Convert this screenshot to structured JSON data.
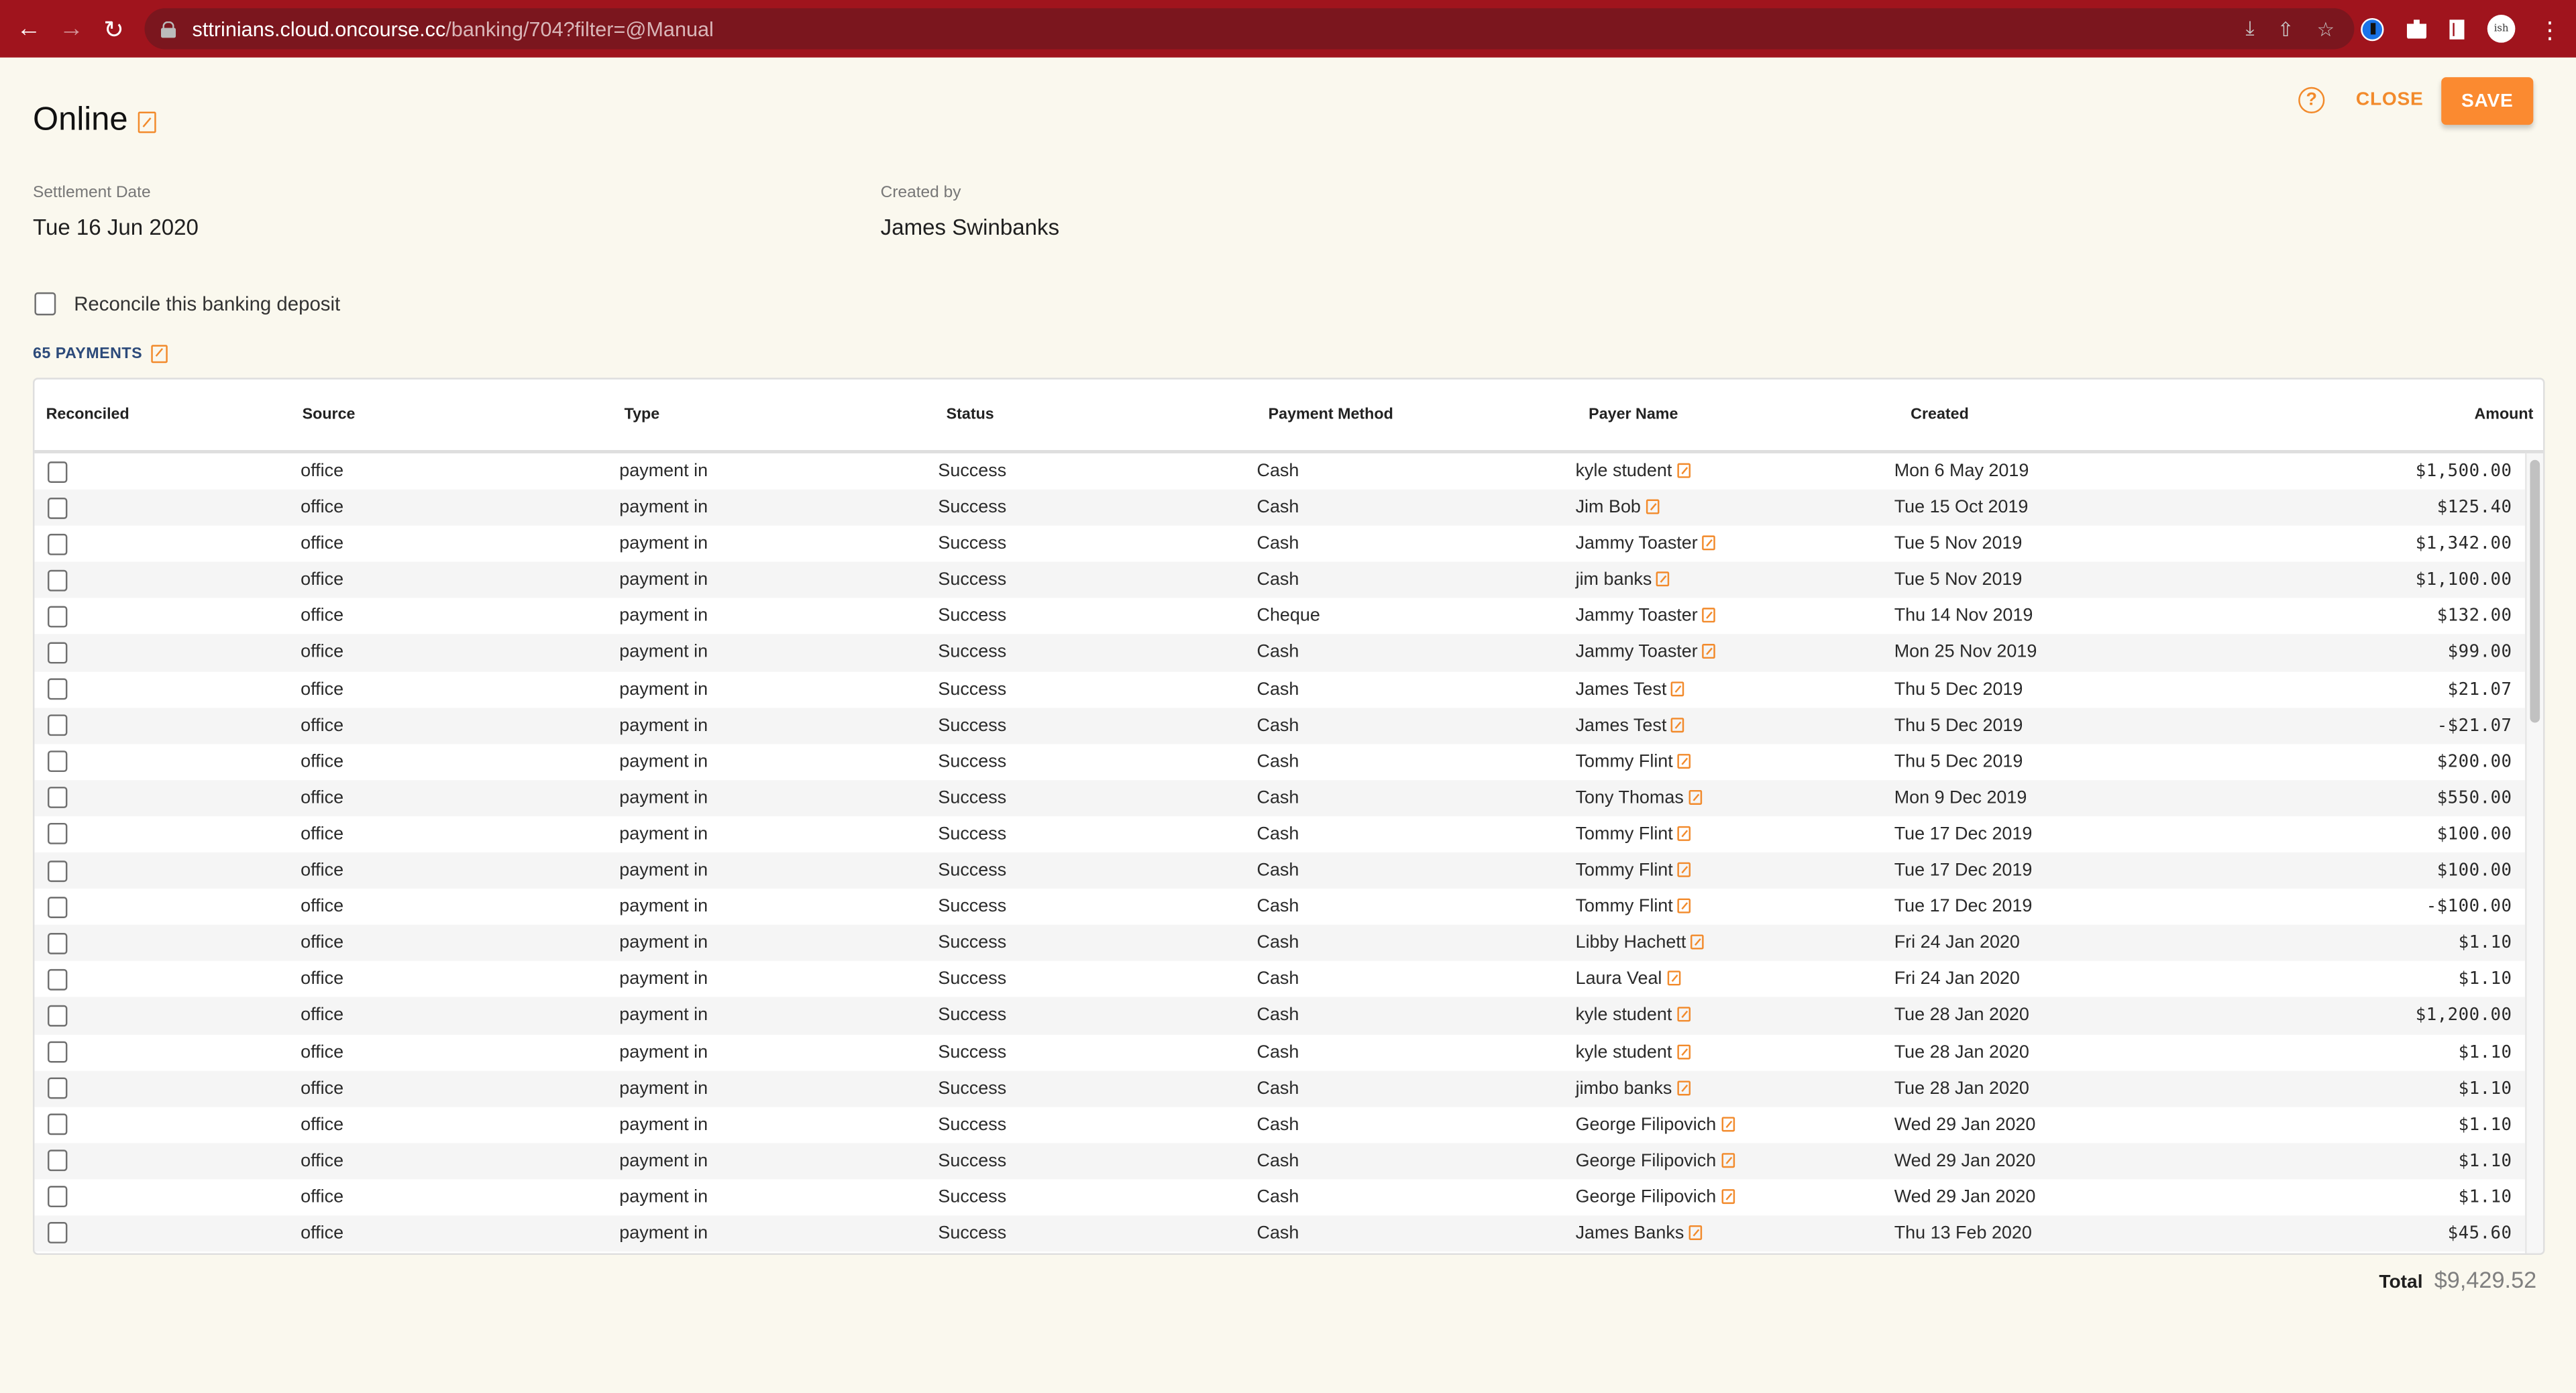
{
  "browser": {
    "url_host": "sttrinians.cloud.oncourse.cc",
    "url_path": "/banking/704?filter=@Manual",
    "icons": [
      "back-icon",
      "forward-icon",
      "reload-icon",
      "lock-icon",
      "install-icon",
      "share-icon",
      "bookmark-star-icon",
      "password-manager-icon",
      "extensions-icon",
      "side-panel-icon",
      "profile-avatar",
      "menu-icon"
    ],
    "avatar_text": "ish"
  },
  "header": {
    "title": "Online",
    "close_label": "CLOSE",
    "save_label": "SAVE",
    "help_glyph": "?"
  },
  "fields": {
    "settlement_date_label": "Settlement Date",
    "settlement_date_value": "Tue 16 Jun 2020",
    "created_by_label": "Created by",
    "created_by_value": "James Swinbanks"
  },
  "reconcile_label": "Reconcile this banking deposit",
  "reconcile_checked": false,
  "payments_link_label": "65 PAYMENTS",
  "table": {
    "columns": [
      "Reconciled",
      "Source",
      "Type",
      "Status",
      "Payment Method",
      "Payer Name",
      "Created",
      "Amount"
    ],
    "rows": [
      {
        "reconciled": false,
        "source": "office",
        "type": "payment in",
        "status": "Success",
        "method": "Cash",
        "payer": "kyle student",
        "created": "Mon 6 May 2019",
        "amount": "$1,500.00"
      },
      {
        "reconciled": false,
        "source": "office",
        "type": "payment in",
        "status": "Success",
        "method": "Cash",
        "payer": "Jim Bob",
        "created": "Tue 15 Oct 2019",
        "amount": "$125.40"
      },
      {
        "reconciled": false,
        "source": "office",
        "type": "payment in",
        "status": "Success",
        "method": "Cash",
        "payer": "Jammy Toaster",
        "created": "Tue 5 Nov 2019",
        "amount": "$1,342.00"
      },
      {
        "reconciled": false,
        "source": "office",
        "type": "payment in",
        "status": "Success",
        "method": "Cash",
        "payer": "jim banks",
        "created": "Tue 5 Nov 2019",
        "amount": "$1,100.00"
      },
      {
        "reconciled": false,
        "source": "office",
        "type": "payment in",
        "status": "Success",
        "method": "Cheque",
        "payer": "Jammy Toaster",
        "created": "Thu 14 Nov 2019",
        "amount": "$132.00"
      },
      {
        "reconciled": false,
        "source": "office",
        "type": "payment in",
        "status": "Success",
        "method": "Cash",
        "payer": "Jammy Toaster",
        "created": "Mon 25 Nov 2019",
        "amount": "$99.00"
      },
      {
        "reconciled": false,
        "source": "office",
        "type": "payment in",
        "status": "Success",
        "method": "Cash",
        "payer": "James Test",
        "created": "Thu 5 Dec 2019",
        "amount": "$21.07"
      },
      {
        "reconciled": false,
        "source": "office",
        "type": "payment in",
        "status": "Success",
        "method": "Cash",
        "payer": "James Test",
        "created": "Thu 5 Dec 2019",
        "amount": "-$21.07"
      },
      {
        "reconciled": false,
        "source": "office",
        "type": "payment in",
        "status": "Success",
        "method": "Cash",
        "payer": "Tommy Flint",
        "created": "Thu 5 Dec 2019",
        "amount": "$200.00"
      },
      {
        "reconciled": false,
        "source": "office",
        "type": "payment in",
        "status": "Success",
        "method": "Cash",
        "payer": "Tony Thomas",
        "created": "Mon 9 Dec 2019",
        "amount": "$550.00"
      },
      {
        "reconciled": false,
        "source": "office",
        "type": "payment in",
        "status": "Success",
        "method": "Cash",
        "payer": "Tommy Flint",
        "created": "Tue 17 Dec 2019",
        "amount": "$100.00"
      },
      {
        "reconciled": false,
        "source": "office",
        "type": "payment in",
        "status": "Success",
        "method": "Cash",
        "payer": "Tommy Flint",
        "created": "Tue 17 Dec 2019",
        "amount": "$100.00"
      },
      {
        "reconciled": false,
        "source": "office",
        "type": "payment in",
        "status": "Success",
        "method": "Cash",
        "payer": "Tommy Flint",
        "created": "Tue 17 Dec 2019",
        "amount": "-$100.00"
      },
      {
        "reconciled": false,
        "source": "office",
        "type": "payment in",
        "status": "Success",
        "method": "Cash",
        "payer": "Libby Hachett",
        "created": "Fri 24 Jan 2020",
        "amount": "$1.10"
      },
      {
        "reconciled": false,
        "source": "office",
        "type": "payment in",
        "status": "Success",
        "method": "Cash",
        "payer": "Laura Veal",
        "created": "Fri 24 Jan 2020",
        "amount": "$1.10"
      },
      {
        "reconciled": false,
        "source": "office",
        "type": "payment in",
        "status": "Success",
        "method": "Cash",
        "payer": "kyle student",
        "created": "Tue 28 Jan 2020",
        "amount": "$1,200.00"
      },
      {
        "reconciled": false,
        "source": "office",
        "type": "payment in",
        "status": "Success",
        "method": "Cash",
        "payer": "kyle student",
        "created": "Tue 28 Jan 2020",
        "amount": "$1.10"
      },
      {
        "reconciled": false,
        "source": "office",
        "type": "payment in",
        "status": "Success",
        "method": "Cash",
        "payer": "jimbo banks",
        "created": "Tue 28 Jan 2020",
        "amount": "$1.10"
      },
      {
        "reconciled": false,
        "source": "office",
        "type": "payment in",
        "status": "Success",
        "method": "Cash",
        "payer": "George Filipovich",
        "created": "Wed 29 Jan 2020",
        "amount": "$1.10"
      },
      {
        "reconciled": false,
        "source": "office",
        "type": "payment in",
        "status": "Success",
        "method": "Cash",
        "payer": "George Filipovich",
        "created": "Wed 29 Jan 2020",
        "amount": "$1.10"
      },
      {
        "reconciled": false,
        "source": "office",
        "type": "payment in",
        "status": "Success",
        "method": "Cash",
        "payer": "George Filipovich",
        "created": "Wed 29 Jan 2020",
        "amount": "$1.10"
      },
      {
        "reconciled": false,
        "source": "office",
        "type": "payment in",
        "status": "Success",
        "method": "Cash",
        "payer": "James Banks",
        "created": "Thu 13 Feb 2020",
        "amount": "$45.60"
      }
    ]
  },
  "total": {
    "label": "Total",
    "value": "$9,429.52"
  },
  "colors": {
    "accent": "#fb8a30",
    "link_blue": "#2c4a7a",
    "browser_bar": "#a0141d",
    "page_bg": "#faf8ee"
  }
}
